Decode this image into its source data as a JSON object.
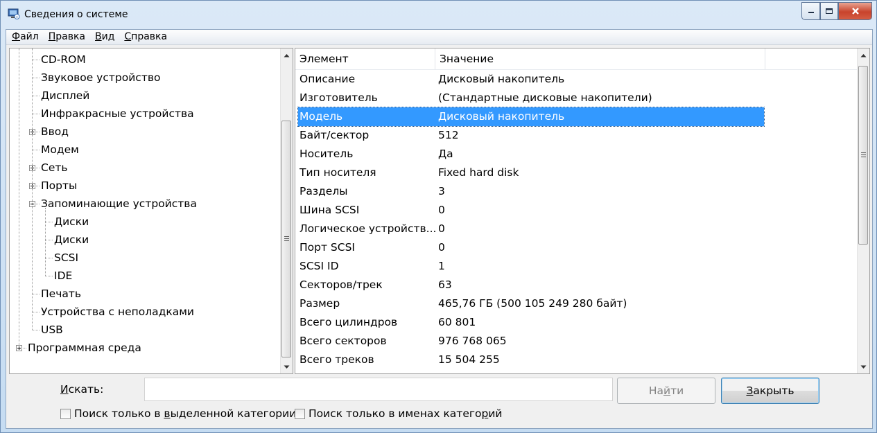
{
  "window": {
    "title": "Сведения о системе"
  },
  "menu": [
    {
      "label": "Файл"
    },
    {
      "label": "Правка"
    },
    {
      "label": "Вид"
    },
    {
      "label": "Справка"
    }
  ],
  "tree": {
    "items": [
      {
        "label": "CD-ROM",
        "level": 1,
        "expander": "none"
      },
      {
        "label": "Звуковое устройство",
        "level": 1,
        "expander": "none"
      },
      {
        "label": "Дисплей",
        "level": 1,
        "expander": "none"
      },
      {
        "label": "Инфракрасные устройства",
        "level": 1,
        "expander": "none"
      },
      {
        "label": "Ввод",
        "level": 1,
        "expander": "plus"
      },
      {
        "label": "Модем",
        "level": 1,
        "expander": "none"
      },
      {
        "label": "Сеть",
        "level": 1,
        "expander": "plus"
      },
      {
        "label": "Порты",
        "level": 1,
        "expander": "plus"
      },
      {
        "label": "Запоминающие устройства",
        "level": 1,
        "expander": "minus"
      },
      {
        "label": "Диски",
        "level": 2,
        "expander": "none"
      },
      {
        "label": "Диски",
        "level": 2,
        "expander": "none"
      },
      {
        "label": "SCSI",
        "level": 2,
        "expander": "none"
      },
      {
        "label": "IDE",
        "level": 2,
        "expander": "none"
      },
      {
        "label": "Печать",
        "level": 1,
        "expander": "none"
      },
      {
        "label": "Устройства с неполадками",
        "level": 1,
        "expander": "none"
      },
      {
        "label": "USB",
        "level": 1,
        "expander": "none"
      },
      {
        "label": "Программная среда",
        "level": 0,
        "expander": "plus"
      }
    ]
  },
  "details": {
    "columns": [
      {
        "label": "Элемент"
      },
      {
        "label": "Значение"
      }
    ],
    "rows": [
      {
        "name": "Описание",
        "value": "Дисковый накопитель"
      },
      {
        "name": "Изготовитель",
        "value": "(Стандартные дисковые накопители)"
      },
      {
        "name": "Модель",
        "value": "Дисковый накопитель",
        "selected": true
      },
      {
        "name": "Байт/сектор",
        "value": "512"
      },
      {
        "name": "Носитель",
        "value": "Да"
      },
      {
        "name": "Тип носителя",
        "value": "Fixed hard disk"
      },
      {
        "name": "Разделы",
        "value": "3"
      },
      {
        "name": "Шина SCSI",
        "value": "0"
      },
      {
        "name": "Логическое устройств...",
        "value": "0"
      },
      {
        "name": "Порт SCSI",
        "value": "0"
      },
      {
        "name": "SCSI ID",
        "value": "1"
      },
      {
        "name": "Секторов/трек",
        "value": "63"
      },
      {
        "name": "Размер",
        "value": "465,76 ГБ (500 105 249 280 байт)"
      },
      {
        "name": "Всего цилиндров",
        "value": "60 801"
      },
      {
        "name": "Всего секторов",
        "value": "976 768 065"
      },
      {
        "name": "Всего треков",
        "value": "15 504 255"
      }
    ]
  },
  "search": {
    "label": "Искать:",
    "value": "",
    "find_button": "Найти",
    "close_button": "Закрыть",
    "checkbox_selected_category": {
      "label": "Поиск только в выделенной категории",
      "checked": false
    },
    "checkbox_category_names": {
      "label": "Поиск только в именах категорий",
      "checked": false
    }
  },
  "icons": {
    "app": "system-info-icon",
    "minimize": "minimize-icon",
    "maximize": "maximize-icon",
    "close": "close-icon"
  }
}
